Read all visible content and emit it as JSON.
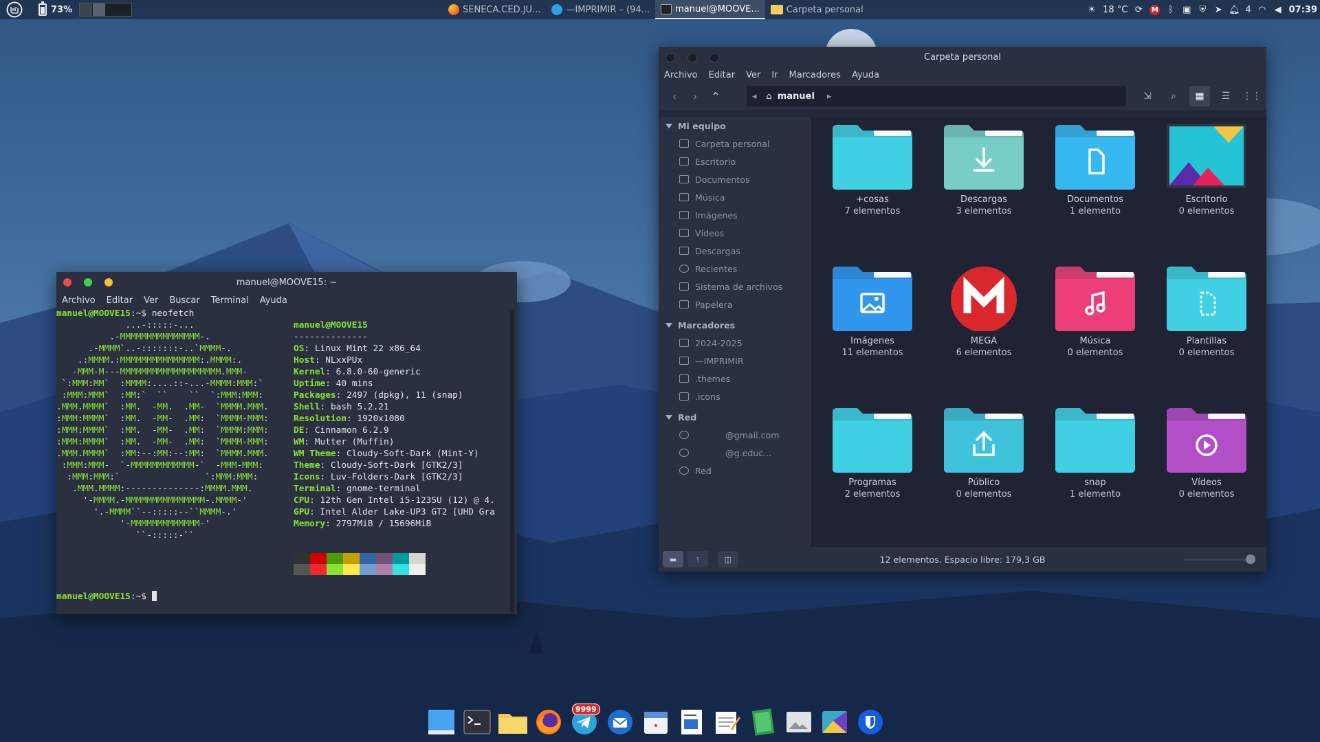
{
  "panel": {
    "battery": "73%",
    "tasks": [
      {
        "label": "SENECA.CED.JU...",
        "icon": "firefox-icon"
      },
      {
        "label": "—IMPRIMIR – (94...",
        "icon": "telegram-icon"
      },
      {
        "label": "manuel@MOOVE...",
        "icon": "terminal-icon"
      },
      {
        "label": "Carpeta personal",
        "icon": "folder-icon"
      }
    ],
    "weather": "18 °C",
    "notif_count": "4",
    "clock": "07:39"
  },
  "terminal": {
    "title": "manuel@MOOVE15: ~",
    "menu": [
      "Archivo",
      "Editar",
      "Ver",
      "Buscar",
      "Terminal",
      "Ayuda"
    ],
    "prompt": "manuel@MOOVE15",
    "prompt_suffix": ":~$ ",
    "command": "neofetch",
    "ascii": [
      "             ...-:::::-...",
      "          .-MMMMMMMMMMMMMMM-.",
      "      .-MMMM`..-:::::::-..`MMMM-.",
      "    .:MMMM.:MMMMMMMMMMMMMMM:.MMMM:.",
      "   -MMM-M---MMMMMMMMMMMMMMMMMMM.MMM-",
      " `:MMM:MM`  :MMMM:....::-...-MMMM:MMM:`",
      " :MMM:MMM`  :MM:`  ``    ``  `:MMM:MMM:",
      ".MMM.MMMM`  :MM.  -MM.  .MM-  `MMMM.MMM.",
      ":MMM:MMMM`  :MM.  -MM-  .MM:  `MMMM-MMM:",
      ":MMM:MMMM`  :MM.  -MM-  .MM:  `MMMM:MMM:",
      ":MMM:MMMM`  :MM.  -MM-  .MM:  `MMMM-MMM:",
      ".MMM.MMMM`  :MM:--:MM:--:MM:  `MMMM.MMM.",
      " :MMM:MMM-  `-MMMMMMMMMMMM-`  -MMM-MMM:",
      "  :MMM:MMM:`                `:MMM:MMM:",
      "   .MMM.MMMM:--------------:MMMM.MMM.",
      "     '-MMMM.-MMMMMMMMMMMMMMM-.MMMM-'",
      "       '.-MMMM``--:::::--``MMMM-.'",
      "            '-MMMMMMMMMMMMM-'",
      "               ``-:::::-``"
    ],
    "user_host": "manuel@MOOVE15",
    "separator": "--------------",
    "info": [
      {
        "k": "OS",
        "v": "Linux Mint 22 x86_64"
      },
      {
        "k": "Host",
        "v": "NLxxPUx"
      },
      {
        "k": "Kernel",
        "v": "6.8.0-60-generic"
      },
      {
        "k": "Uptime",
        "v": "40 mins"
      },
      {
        "k": "Packages",
        "v": "2497 (dpkg), 11 (snap)"
      },
      {
        "k": "Shell",
        "v": "bash 5.2.21"
      },
      {
        "k": "Resolution",
        "v": "1920x1080"
      },
      {
        "k": "DE",
        "v": "Cinnamon 6.2.9"
      },
      {
        "k": "WM",
        "v": "Mutter (Muffin)"
      },
      {
        "k": "WM Theme",
        "v": "Cloudy-Soft-Dark (Mint-Y)"
      },
      {
        "k": "Theme",
        "v": "Cloudy-Soft-Dark [GTK2/3]"
      },
      {
        "k": "Icons",
        "v": "Luv-Folders-Dark [GTK2/3]"
      },
      {
        "k": "Terminal",
        "v": "gnome-terminal"
      },
      {
        "k": "CPU",
        "v": "12th Gen Intel i5-1235U (12) @ 4."
      },
      {
        "k": "GPU",
        "v": "Intel Alder Lake-UP3 GT2 [UHD Gra"
      },
      {
        "k": "Memory",
        "v": "2797MiB / 15696MiB"
      }
    ],
    "palette_top": [
      "#2e3436",
      "#cc0000",
      "#4e9a06",
      "#c4a000",
      "#3465a4",
      "#75507b",
      "#06989a",
      "#d3d7cf"
    ],
    "palette_bottom": [
      "#555753",
      "#ef2929",
      "#8ae234",
      "#fce94f",
      "#729fcf",
      "#ad7fa8",
      "#34e2e2",
      "#eeeeec"
    ]
  },
  "filemanager": {
    "title": "Carpeta personal",
    "menu": [
      "Archivo",
      "Editar",
      "Ver",
      "Ir",
      "Marcadores",
      "Ayuda"
    ],
    "path": "manuel",
    "sidebar": {
      "sections": [
        {
          "title": "Mi equipo",
          "items": [
            "Carpeta personal",
            "Escritorio",
            "Documentos",
            "Música",
            "Imágenes",
            "Vídeos",
            "Descargas",
            "Recientes",
            "Sistema de archivos",
            "Papelera"
          ]
        },
        {
          "title": "Marcadores",
          "items": [
            "2024-2025",
            "—IMPRIMIR",
            ".themes",
            ".icons"
          ]
        },
        {
          "title": "Red",
          "items": [
            "@gmail.com",
            "@g.educ...",
            "Red"
          ]
        }
      ]
    },
    "items": [
      {
        "name": "+cosas",
        "count": "7 elementos",
        "kind": "plain",
        "color": "#3fd1e3"
      },
      {
        "name": "Descargas",
        "count": "3 elementos",
        "kind": "download",
        "color": "#78cdc4"
      },
      {
        "name": "Documentos",
        "count": "1  elemento",
        "kind": "document",
        "color": "#35b9f0"
      },
      {
        "name": "Escritorio",
        "count": "0 elementos",
        "kind": "desktop",
        "color": "#24c3d6"
      },
      {
        "name": "Imágenes",
        "count": "11 elementos",
        "kind": "image",
        "color": "#3197ee"
      },
      {
        "name": "MEGA",
        "count": "6 elementos",
        "kind": "mega",
        "color": "#d9272e"
      },
      {
        "name": "Música",
        "count": "0 elementos",
        "kind": "music",
        "color": "#ec3f78"
      },
      {
        "name": "Plantillas",
        "count": "0 elementos",
        "kind": "template",
        "color": "#3fd1e3"
      },
      {
        "name": "Programas",
        "count": "2 elementos",
        "kind": "plain",
        "color": "#3fd1e3"
      },
      {
        "name": "Público",
        "count": "0 elementos",
        "kind": "share",
        "color": "#3fc2db"
      },
      {
        "name": "snap",
        "count": "1  elemento",
        "kind": "plain",
        "color": "#3fd1e3"
      },
      {
        "name": "Vídeos",
        "count": "0 elementos",
        "kind": "video",
        "color": "#b24fc7"
      }
    ],
    "status": "12 elementos. Espacio libre: 179,3 GB"
  },
  "dock": {
    "telegram_badge": "9999",
    "items": [
      "file-manager-desktop-icon",
      "terminal-icon",
      "files-icon",
      "firefox-icon",
      "telegram-icon",
      "thunderbird-icon",
      "calendar-icon",
      "writer-icon",
      "text-editor-icon",
      "calc-icon",
      "image-viewer-icon",
      "mintinstall-icon",
      "bitwarden-icon"
    ]
  }
}
